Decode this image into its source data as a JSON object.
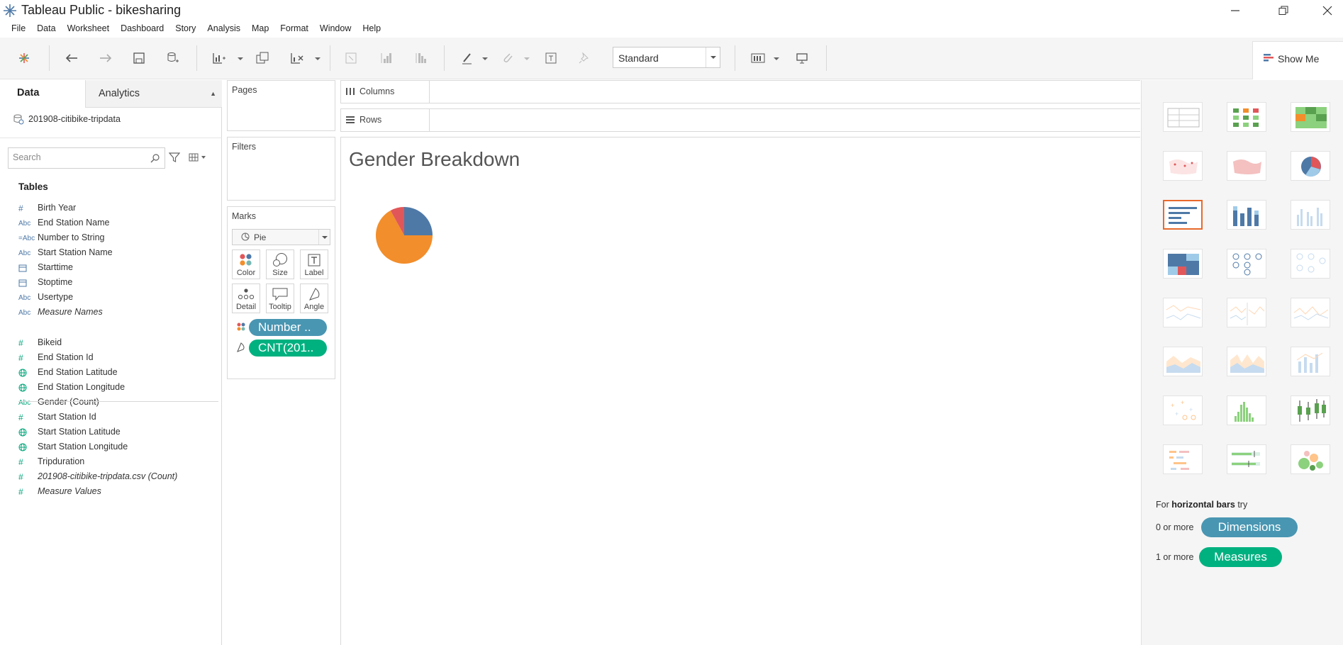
{
  "window": {
    "title": "Tableau Public - bikesharing",
    "controls": [
      "minimize",
      "restore",
      "close"
    ]
  },
  "menu": [
    "File",
    "Data",
    "Worksheet",
    "Dashboard",
    "Story",
    "Analysis",
    "Map",
    "Format",
    "Window",
    "Help"
  ],
  "toolbar": {
    "fit_value": "Standard",
    "show_me_label": "Show Me"
  },
  "data_pane": {
    "tabs": {
      "data": "Data",
      "analytics": "Analytics"
    },
    "datasource": "201908-citibike-tripdata",
    "search_placeholder": "Search",
    "tables_header": "Tables",
    "dimensions": [
      {
        "icon": "#",
        "label": "Birth Year",
        "kind": "dim",
        "italic": false
      },
      {
        "icon": "Abc",
        "label": "End Station Name",
        "kind": "dim",
        "italic": false
      },
      {
        "icon": "=Abc",
        "label": "Number to String",
        "kind": "dim",
        "italic": false
      },
      {
        "icon": "Abc",
        "label": "Start Station Name",
        "kind": "dim",
        "italic": false
      },
      {
        "icon": "date",
        "label": "Starttime",
        "kind": "dim",
        "italic": false
      },
      {
        "icon": "date",
        "label": "Stoptime",
        "kind": "dim",
        "italic": false
      },
      {
        "icon": "Abc",
        "label": "Usertype",
        "kind": "dim",
        "italic": false
      },
      {
        "icon": "Abc",
        "label": "Measure Names",
        "kind": "dim",
        "italic": true
      }
    ],
    "measures": [
      {
        "icon": "#",
        "label": "Bikeid",
        "kind": "mea",
        "italic": false
      },
      {
        "icon": "#",
        "label": "End Station Id",
        "kind": "mea",
        "italic": false
      },
      {
        "icon": "globe",
        "label": "End Station Latitude",
        "kind": "mea",
        "italic": false
      },
      {
        "icon": "globe",
        "label": "End Station Longitude",
        "kind": "mea",
        "italic": false
      },
      {
        "icon": "Abc",
        "label": "Gender (Count)",
        "kind": "mea",
        "italic": false
      },
      {
        "icon": "#",
        "label": "Start Station Id",
        "kind": "mea",
        "italic": false
      },
      {
        "icon": "globe",
        "label": "Start Station Latitude",
        "kind": "mea",
        "italic": false
      },
      {
        "icon": "globe",
        "label": "Start Station Longitude",
        "kind": "mea",
        "italic": false
      },
      {
        "icon": "#",
        "label": "Tripduration",
        "kind": "mea",
        "italic": false
      },
      {
        "icon": "#",
        "label": "201908-citibike-tripdata.csv (Count)",
        "kind": "mea",
        "italic": true
      },
      {
        "icon": "#",
        "label": "Measure Values",
        "kind": "mea",
        "italic": true
      }
    ]
  },
  "cards": {
    "pages": "Pages",
    "filters": "Filters",
    "marks": "Marks",
    "mark_type": "Pie",
    "mark_buttons": [
      "Color",
      "Size",
      "Label",
      "Detail",
      "Tooltip",
      "Angle"
    ],
    "pills": [
      {
        "text": "Number ..",
        "kind": "dim",
        "encoding": "color"
      },
      {
        "text": "CNT(201..",
        "kind": "mea",
        "encoding": "angle"
      }
    ]
  },
  "shelves": {
    "columns": "Columns",
    "rows": "Rows"
  },
  "viz": {
    "title": "Gender Breakdown"
  },
  "chart_data": {
    "type": "pie",
    "slices": [
      {
        "value": 0.25,
        "color": "#4e79a7"
      },
      {
        "value": 0.67,
        "color": "#f28e2b"
      },
      {
        "value": 0.08,
        "color": "#e15759"
      }
    ]
  },
  "show_me": {
    "hint_prefix": "For",
    "hint_bold": "horizontal bars",
    "hint_suffix": "try",
    "req1_text": "0 or more",
    "req1_pill": "Dimensions",
    "req2_text": "1 or more",
    "req2_pill": "Measures",
    "selected_index": 6
  },
  "colors": {
    "dimension": "#4996b2",
    "measure": "#00b180",
    "selected": "#e8692c"
  }
}
